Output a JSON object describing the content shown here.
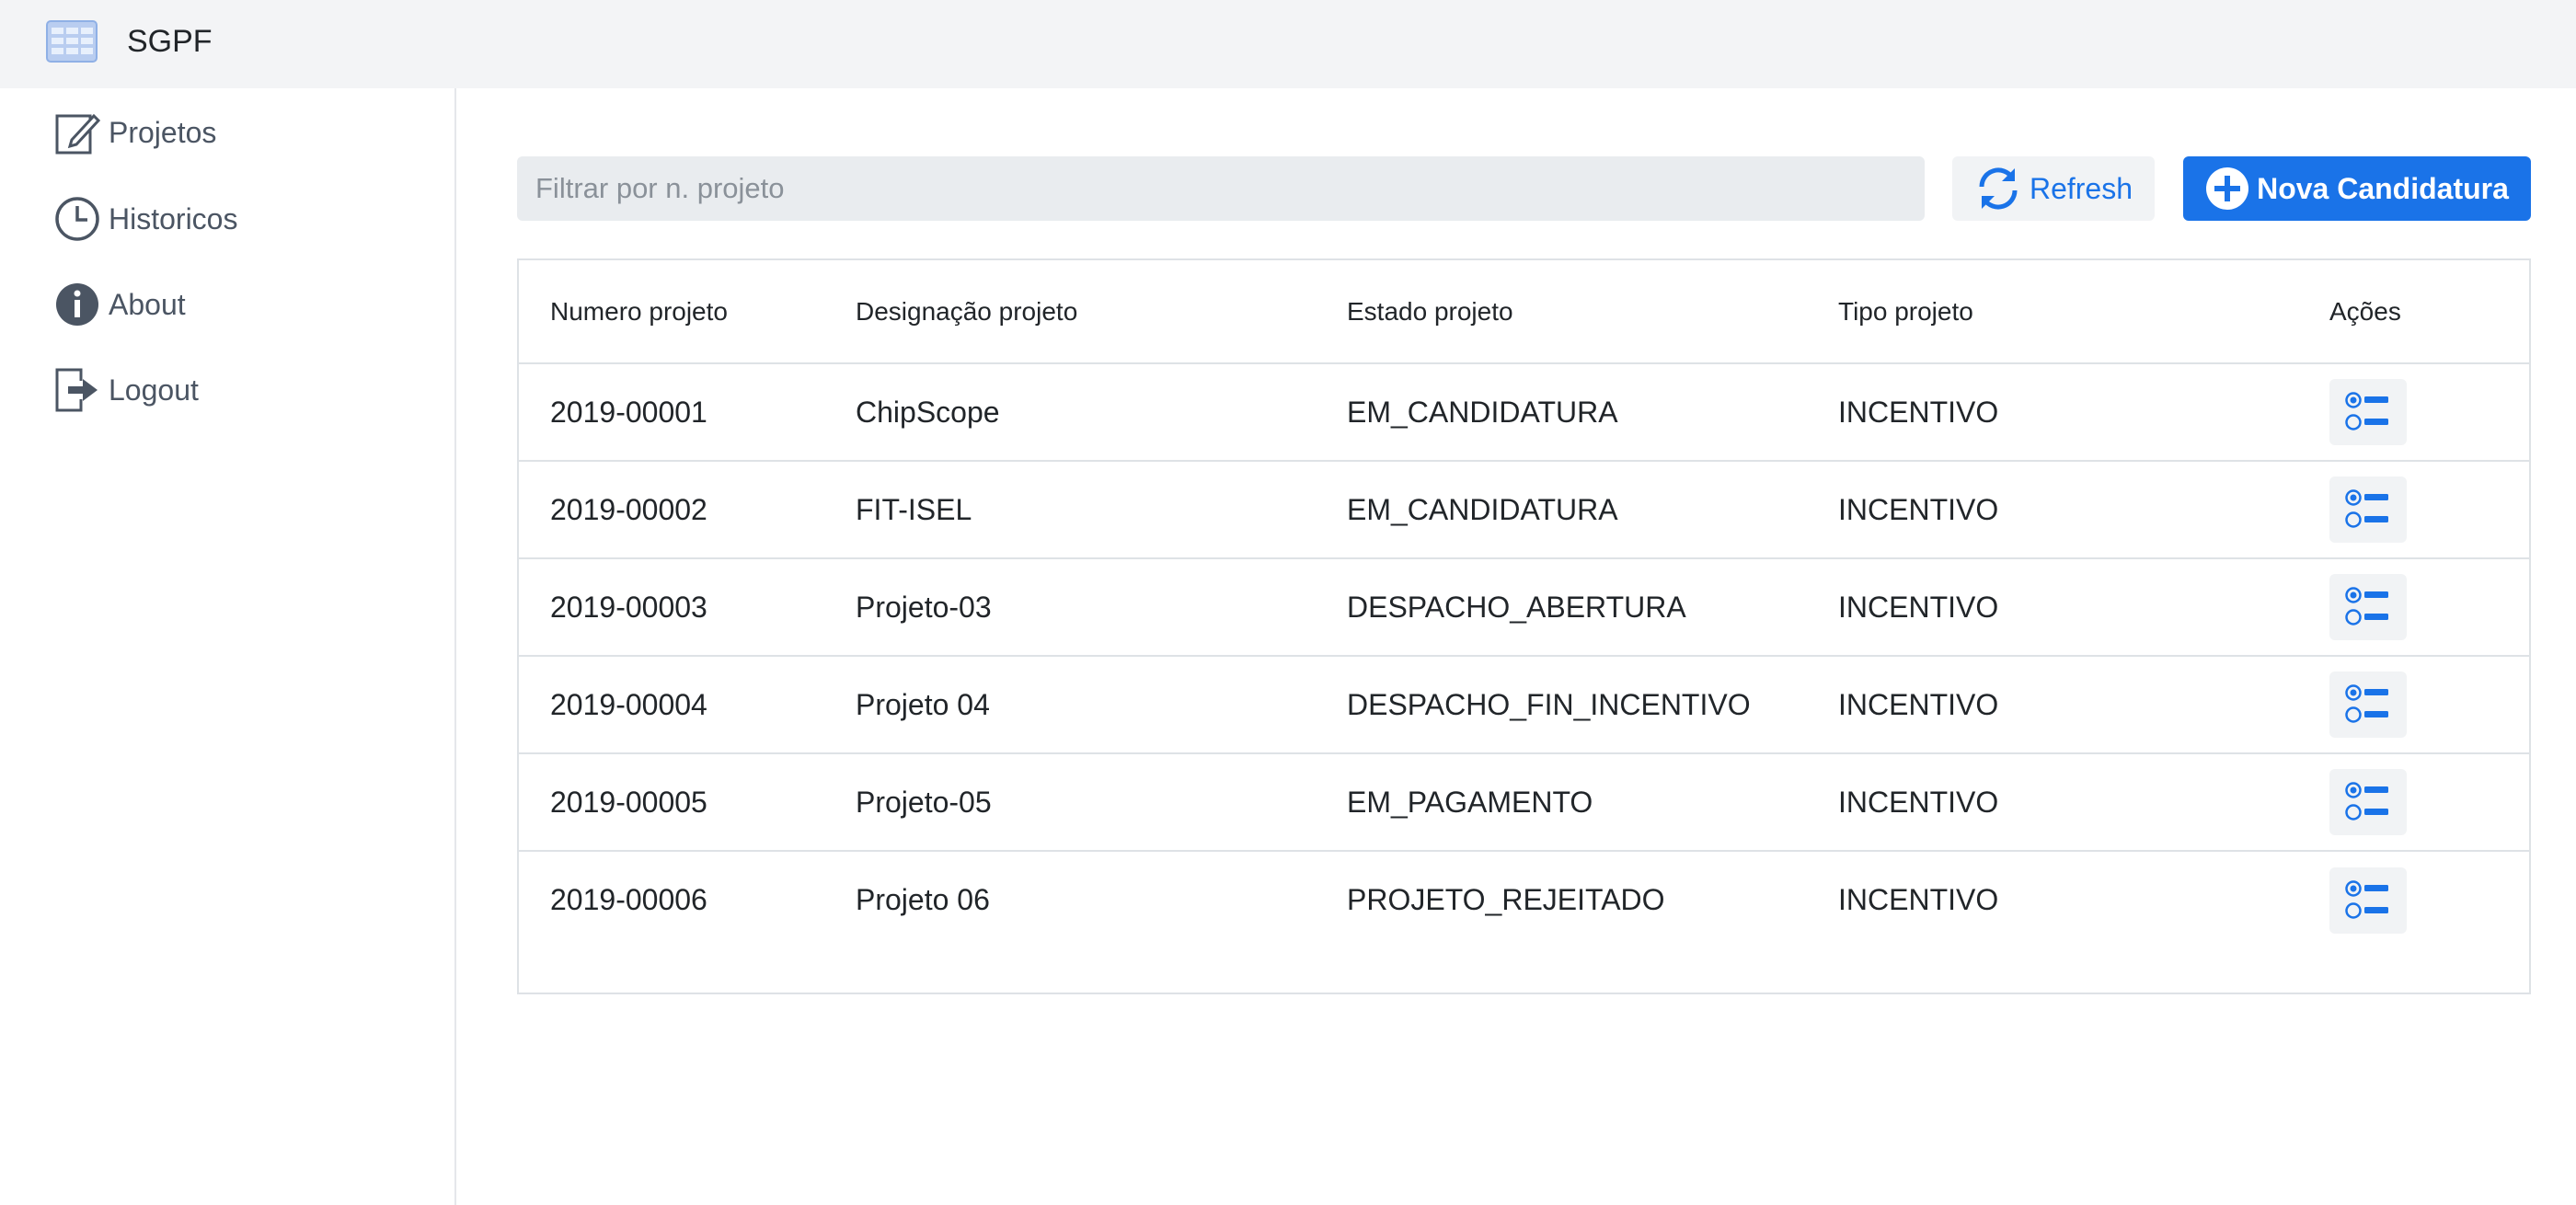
{
  "app": {
    "title": "SGPF",
    "logo_icon": "table-grid-icon"
  },
  "sidebar": {
    "items": [
      {
        "label": "Projetos",
        "icon": "edit-icon"
      },
      {
        "label": "Historicos",
        "icon": "clock-icon"
      },
      {
        "label": "About",
        "icon": "info-icon"
      },
      {
        "label": "Logout",
        "icon": "logout-icon"
      }
    ]
  },
  "toolbar": {
    "filter_placeholder": "Filtrar por n. projeto",
    "filter_value": "",
    "refresh_label": "Refresh",
    "new_label": "Nova Candidatura"
  },
  "table": {
    "headers": [
      "Numero projeto",
      "Designação projeto",
      "Estado projeto",
      "Tipo projeto",
      "Ações"
    ],
    "rows": [
      [
        "2019-00001",
        "ChipScope",
        "EM_CANDIDATURA",
        "INCENTIVO"
      ],
      [
        "2019-00002",
        "FIT-ISEL",
        "EM_CANDIDATURA",
        "INCENTIVO"
      ],
      [
        "2019-00003",
        "Projeto-03",
        "DESPACHO_ABERTURA",
        "INCENTIVO"
      ],
      [
        "2019-00004",
        "Projeto 04",
        "DESPACHO_FIN_INCENTIVO",
        "INCENTIVO"
      ],
      [
        "2019-00005",
        "Projeto-05",
        "EM_PAGAMENTO",
        "INCENTIVO"
      ],
      [
        "2019-00006",
        "Projeto 06",
        "PROJETO_REJEITADO",
        "INCENTIVO"
      ]
    ]
  },
  "colors": {
    "accent": "#1a73e8",
    "topbar": "#f3f4f6",
    "muted_icon": "#4b5563"
  }
}
